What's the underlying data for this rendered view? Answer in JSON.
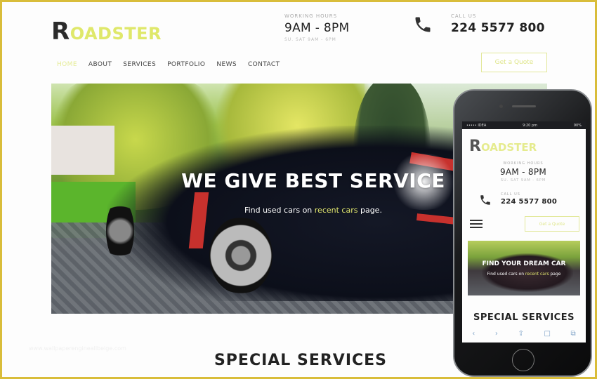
{
  "brand": {
    "logo_first": "R",
    "logo_rest": "OADSTER",
    "accent_color": "#dfe86a",
    "border_color": "#d9bd3a"
  },
  "header": {
    "hours_label": "WORKING HOURS",
    "hours_value": "9AM - 8PM",
    "hours_sub": "SU. SAT 9AM - 6PM",
    "call_label": "CALL US",
    "call_value": "224 5577 800",
    "phone_icon": "phone-icon"
  },
  "nav": {
    "items": [
      {
        "label": "HOME",
        "active": true
      },
      {
        "label": "ABOUT"
      },
      {
        "label": "SERVICES"
      },
      {
        "label": "PORTFOLIO"
      },
      {
        "label": "NEWS"
      },
      {
        "label": "CONTACT"
      }
    ],
    "quote_label": "Get a Quote"
  },
  "hero": {
    "title": "WE GIVE BEST SERVICE",
    "sub_before": "Find used cars on ",
    "sub_highlight": "recent cars",
    "sub_after": " page."
  },
  "section": {
    "title": "SPECIAL SERVICES"
  },
  "watermark": "www.wallpaperengineallbeige.com",
  "mobile": {
    "status": {
      "carrier": "••••• IDEA",
      "time": "9:20 pm",
      "battery": "90%"
    },
    "hours_label": "WORKING HOURS",
    "hours_value": "9AM - 8PM",
    "hours_sub": "SU. SAT 9AM - 6PM",
    "call_label": "CALL US",
    "call_value": "224 5577 800",
    "quote_label": "Get a Quote",
    "hero_title": "FIND YOUR DREAM CAR",
    "hero_sub_before": "Find used cars on ",
    "hero_sub_highlight": "recent cars",
    "hero_sub_after": " page",
    "section_title": "SPECIAL SERVICES",
    "toolbar": {
      "back": "‹",
      "forward": "›",
      "share": "⇪",
      "bookmarks": "□",
      "tabs": "⧉"
    }
  }
}
